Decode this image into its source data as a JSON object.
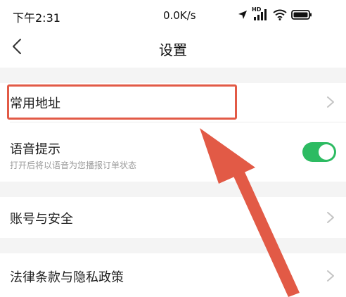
{
  "status_bar": {
    "time": "下午2:31",
    "speed": "0.0K/s",
    "network_badge": "HD",
    "icons": [
      "location-arrow-icon",
      "signal-icon",
      "wifi-icon",
      "battery-icon"
    ]
  },
  "header": {
    "title": "设置",
    "back_icon": "chevron-left-icon"
  },
  "rows": {
    "common_address": {
      "label": "常用地址"
    },
    "voice_prompt": {
      "label": "语音提示",
      "subtitle": "打开后将以语音为您播报订单状态",
      "toggle_on": true
    },
    "account_security": {
      "label": "账号与安全"
    },
    "legal_privacy": {
      "label": "法律条款与隐私政策"
    }
  },
  "colors": {
    "toggle_on": "#2dbb62",
    "annotation": "#e25a46",
    "separator": "#f4f4f4",
    "chevron": "#c4c4c4"
  }
}
